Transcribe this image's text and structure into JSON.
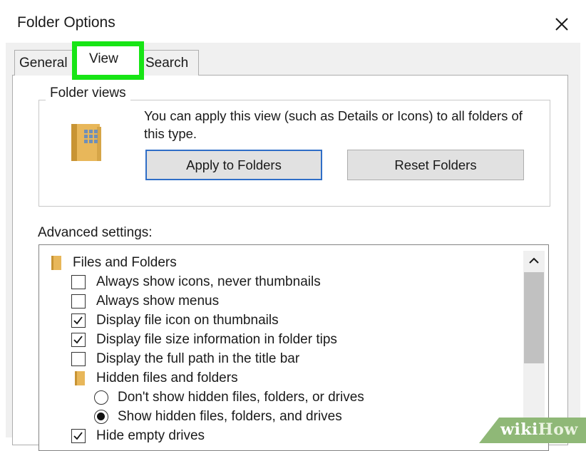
{
  "dialog": {
    "title": "Folder Options"
  },
  "tabs": [
    {
      "label": "General"
    },
    {
      "label": "View"
    },
    {
      "label": "Search"
    }
  ],
  "folder_views": {
    "label": "Folder views",
    "description": "You can apply this view (such as Details or Icons) to all folders of this type.",
    "apply_button": "Apply to Folders",
    "reset_button": "Reset Folders"
  },
  "advanced": {
    "label": "Advanced settings:",
    "items": [
      {
        "type": "folder",
        "label": "Files and Folders"
      },
      {
        "type": "checkbox",
        "label": "Always show icons, never thumbnails",
        "checked": false
      },
      {
        "type": "checkbox",
        "label": "Always show menus",
        "checked": false
      },
      {
        "type": "checkbox",
        "label": "Display file icon on thumbnails",
        "checked": true
      },
      {
        "type": "checkbox",
        "label": "Display file size information in folder tips",
        "checked": true
      },
      {
        "type": "checkbox",
        "label": "Display the full path in the title bar",
        "checked": false
      },
      {
        "type": "folder",
        "label": "Hidden files and folders"
      },
      {
        "type": "radio",
        "label": "Don't show hidden files, folders, or drives",
        "checked": false
      },
      {
        "type": "radio",
        "label": "Show hidden files, folders, and drives",
        "checked": true
      },
      {
        "type": "checkbox",
        "label": "Hide empty drives",
        "checked": true
      }
    ]
  },
  "watermark": {
    "part1": "wiki",
    "part2": "How"
  },
  "colors": {
    "highlight": "#17e515",
    "accent": "#2f6ec7",
    "folder": "#e8b75a"
  },
  "icons": {
    "close": "close-icon",
    "folder": "folder-icon",
    "scroll_up": "chevron-up-icon"
  }
}
